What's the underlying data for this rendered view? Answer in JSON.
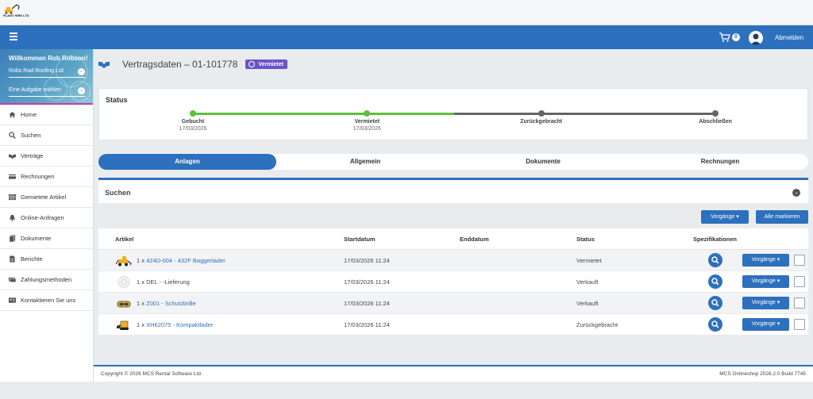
{
  "brand": {
    "logo_text": "PLANT HIRE LTD"
  },
  "navbar": {
    "cart_count": "0",
    "logout_label": "Abmelden"
  },
  "sidebar": {
    "welcome": "Willkommen Rob Robson!",
    "company_select": "Robs Rad Roofing Ltd",
    "task_select": "Eine Aufgabe wählen",
    "items": [
      {
        "label": "Home",
        "icon": "home-icon"
      },
      {
        "label": "Suchen",
        "icon": "search-icon"
      },
      {
        "label": "Verträge",
        "icon": "handshake-icon"
      },
      {
        "label": "Rechnungen",
        "icon": "credit-card-icon"
      },
      {
        "label": "Gemietete Artikel",
        "icon": "grid-icon"
      },
      {
        "label": "Online-Anfragen",
        "icon": "bell-icon"
      },
      {
        "label": "Dokumente",
        "icon": "documents-icon"
      },
      {
        "label": "Berichte",
        "icon": "file-icon"
      },
      {
        "label": "Zahlungsmethoden",
        "icon": "money-icon"
      },
      {
        "label": "Kontaktieren Sie uns",
        "icon": "contact-card-icon"
      }
    ]
  },
  "page": {
    "title": "Vertragsdaten – 01-101778",
    "badge": "Vermietet"
  },
  "status": {
    "title": "Status",
    "steps": [
      {
        "label": "Gebucht",
        "date": "17/03/2026",
        "state": "done"
      },
      {
        "label": "Vermietet",
        "date": "17/03/2026",
        "state": "done"
      },
      {
        "label": "Zurückgebracht",
        "date": "",
        "state": "pending"
      },
      {
        "label": "Abschließen",
        "date": "",
        "state": "pending"
      }
    ],
    "progress": 0.5,
    "colors": {
      "done": "#5cc13a",
      "pending": "#666666"
    }
  },
  "tabs": [
    {
      "label": "Anlagen",
      "active": true
    },
    {
      "label": "Allgemein",
      "active": false
    },
    {
      "label": "Dokumente",
      "active": false
    },
    {
      "label": "Rechnungen",
      "active": false
    }
  ],
  "search": {
    "title": "Suchen"
  },
  "actions": {
    "vorgaenge": "Vorgänge",
    "mark_all": "Alle markieren"
  },
  "table": {
    "headers": {
      "artikel": "Artikel",
      "start": "Startdatum",
      "end": "Enddatum",
      "status": "Status",
      "spec": "Spezifikationen"
    },
    "rows": [
      {
        "qty": "1 x",
        "code": "424D-004 - 432F Baggerlader",
        "start": "17/03/2026 11:24",
        "end": "",
        "status": "Vermietet",
        "link": true,
        "action": "Vorgänge"
      },
      {
        "qty": "1 x",
        "code": "DEL - -Lieferung",
        "start": "17/03/2026 11:24",
        "end": "",
        "status": "Verkauft",
        "link": false,
        "action": "Vorgänge"
      },
      {
        "qty": "1 x",
        "code": "Z001 - Schutzbrille",
        "start": "17/03/2026 11:24",
        "end": "",
        "status": "Verkauft",
        "link": true,
        "action": "Vorgänge"
      },
      {
        "qty": "1 x",
        "code": "XH62075 - Kompaktlader",
        "start": "17/03/2026 11:24",
        "end": "",
        "status": "Zurückgebracht",
        "link": true,
        "action": "Vorgänge"
      }
    ]
  },
  "footer": {
    "copyright": "Copyright © 2026 MCS Rental Software Ltd.",
    "version": "MCS Onlineshop 2026.2.0  Build 7745"
  },
  "colors": {
    "primary": "#2d70bd",
    "badge": "#6a55c7",
    "accent": "#c73fa8"
  }
}
